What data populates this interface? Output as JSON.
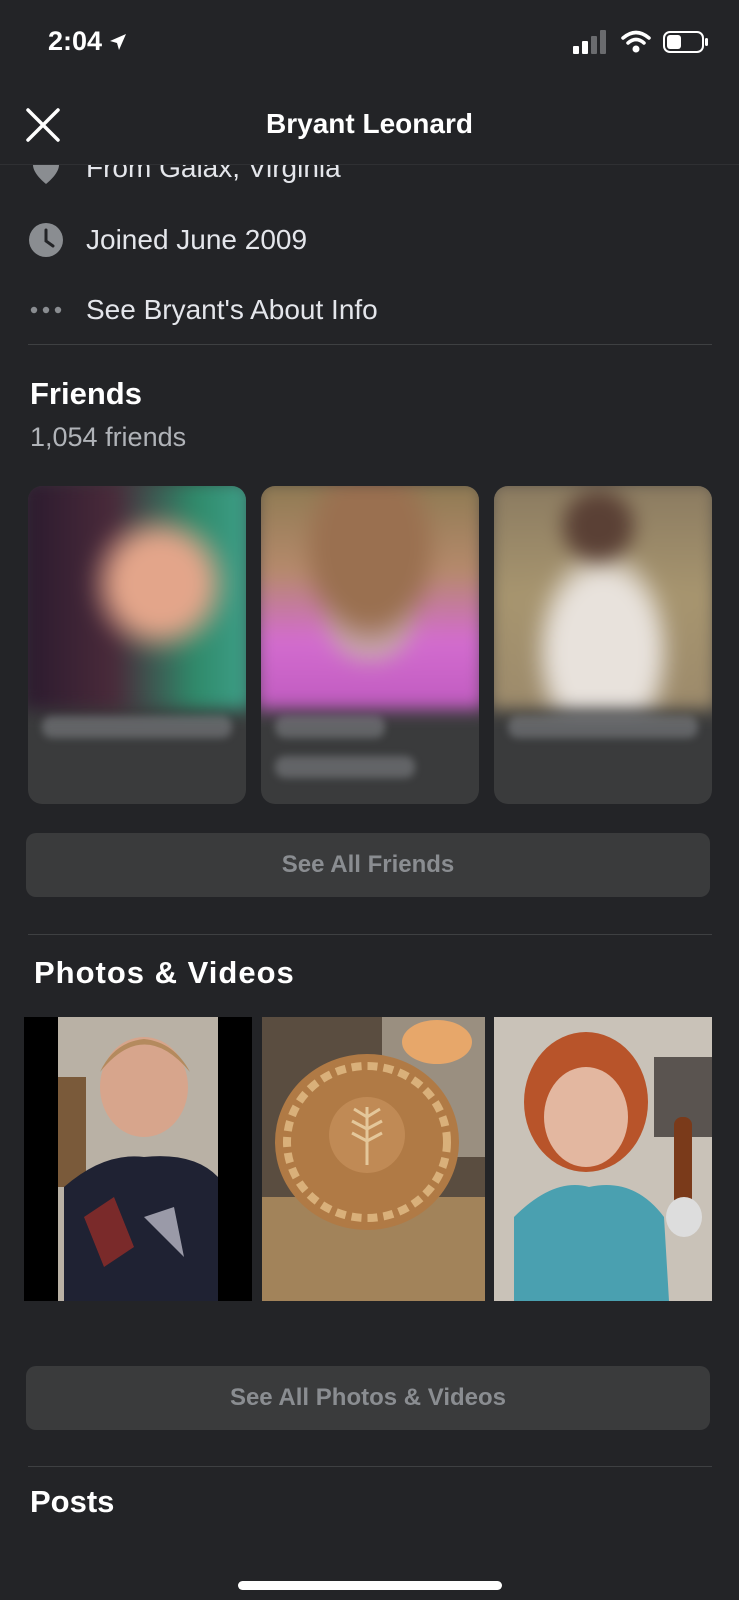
{
  "status": {
    "time": "2:04"
  },
  "header": {
    "title": "Bryant Leonard"
  },
  "about": {
    "from": "From Galax, Virginia",
    "joined": "Joined June 2009",
    "see_about": "See Bryant's About Info"
  },
  "friends": {
    "title": "Friends",
    "count": "1,054 friends",
    "see_all": "See All Friends"
  },
  "photos": {
    "title": "Photos & Videos",
    "see_all": "See All Photos & Videos"
  },
  "posts": {
    "title": "Posts"
  }
}
